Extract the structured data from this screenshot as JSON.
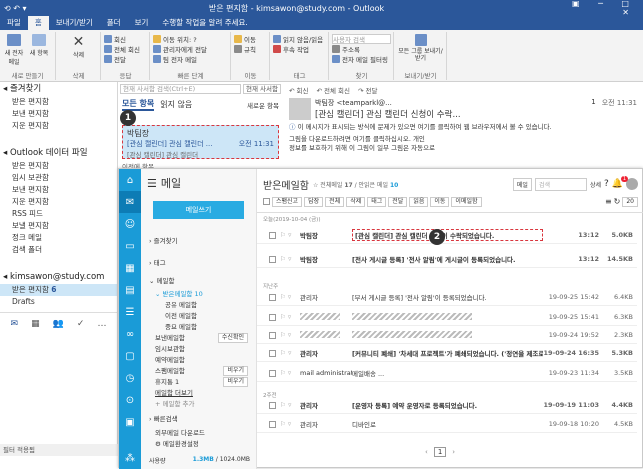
{
  "outlook": {
    "title": "받은 편지함 - kimsawon@study.com - Outlook",
    "tabs": [
      "파일",
      "홈",
      "보내기/받기",
      "폴더",
      "보기",
      "수행할 작업을 알려 주세요."
    ],
    "ribbon": {
      "new_email": "새 전자 메일",
      "new_items": "새 항목",
      "delete": "삭제",
      "reply": "회신",
      "reply_all": "전체 회신",
      "forward": "전달",
      "move_to": "이동 위치: ?",
      "to_manager": "관리자에게 전달",
      "team_email": "팀 전자 메일",
      "move": "이동",
      "rules": "규칙",
      "unread_read": "읽지 않음/읽음",
      "follow_up": "후속 작업",
      "search_people": "사용자 검색",
      "address_book": "주소록",
      "filter_email": "전자 메일 필터링",
      "all_groups": "모든 그룹 보내기/받기",
      "groups": [
        "새로 만들기",
        "삭제",
        "응답",
        "빠른 단계",
        "이동",
        "태그",
        "찾기",
        "보내기/받기"
      ]
    },
    "nav": {
      "favorites": "즐겨찾기",
      "fav_items": [
        "받은 편지함",
        "보낸 편지함",
        "지운 편지함"
      ],
      "data_file": "Outlook 데이터 파일",
      "data_items": [
        "받은 편지함",
        "임시 보관함",
        "보낸 편지함",
        "지운 편지함",
        "RSS 피드",
        "보낼 편지함",
        "정크 메일",
        "검색 폴더"
      ],
      "account": "kimsawon@study.com",
      "acc_inbox": "받은 편지함",
      "acc_inbox_count": "6",
      "acc_drafts": "Drafts",
      "status": "필터 적용됨"
    },
    "list": {
      "search_placeholder": "현재 사서함 검색(Ctrl+E)",
      "scope": "현재 사서함",
      "tab_all": "모든 항목",
      "tab_unread": "읽지 않음",
      "sort": "새로운 항목",
      "today": "오늘",
      "sender": "박팀장",
      "subject": "[관심 캘린더] 관심 캘린더 ...",
      "time": "오전 11:31",
      "preview": "[관심 캘린더] 관심 캘린더",
      "group_last": "이전에 항목"
    },
    "reading": {
      "reply": "회신",
      "reply_all": "전체 회신",
      "forward": "전달",
      "from": "박팀장 <teamparkl@...",
      "people": "1",
      "time": "오전 11:31",
      "subject": "[관심 캘린더] 관심 캘린더 신청이 수락...",
      "info": "이 메시지가 표시되는 방식에 문제가 있으면 여기를 클릭하여 웹 브라우저에서 볼 수 있습니다.",
      "body1": "그림을 다운로드하려면 여기를 클릭하십시오. 개인",
      "body2": "정보를 보호하기 위해 이 그림이 일부 그림은 자동으로"
    },
    "badge1": "1"
  },
  "webmail": {
    "logo": "메일",
    "compose": "메일쓰기",
    "side": [
      "즐겨찾기",
      "태그",
      "메일함",
      "받은메일함",
      "공유 메일함",
      "이전 메일함",
      "중요 메일함",
      "보낸메일함",
      "임시보관함",
      "예약메일함",
      "스팸메일함",
      "휴지통",
      "메일함 더보기",
      "+ 메일함 추가",
      "빠른검색",
      "외부메일 다운로드",
      "메일환경설정"
    ],
    "side_count": "10",
    "trash_count": "1",
    "side_empty": "비우기",
    "side_ext": "수신확인",
    "storage": "사용량",
    "storage_used": "1.3MB",
    "storage_total": "1024.0MB",
    "header": {
      "title": "받은메일함",
      "total_label": "전체메일",
      "total": "17",
      "unread_label": "안읽은 메일",
      "unread": "10",
      "search_scope": "메일",
      "search_placeholder": "검색",
      "detail": "상세",
      "notif_count": "1"
    },
    "toolbar": [
      "스팸신고",
      "답장",
      "전체",
      "삭제",
      "태그",
      "전달",
      "읽음",
      "이동",
      "이메일함"
    ],
    "page_size": "20",
    "group_today": "오늘(2019-10-04 (금))",
    "group_week": "지난주",
    "group_2w": "2주전",
    "rows": [
      {
        "from": "박팀장",
        "subject": "[관심 캘린더] 관심 캘린더 신청이 수락되었습니다.",
        "date": "13:12",
        "size": "5.0KB"
      },
      {
        "from": "박팀장",
        "subject": "[전사 게시글 등록] '전사 알림'에 게시글이 등록되었습니다.",
        "date": "13:12",
        "size": "14.5KB"
      },
      {
        "from": "관리자",
        "subject": "[부서 게시글 등록] '전사 알림'이 등록되었습니다.",
        "date": "19-09-25 15:42",
        "size": "6.4KB"
      },
      {
        "from": "",
        "subject": "",
        "date": "19-09-25 15:41",
        "size": "6.3KB"
      },
      {
        "from": "",
        "subject": "",
        "date": "19-09-24 19:52",
        "size": "2.3KB"
      },
      {
        "from": "관리자",
        "subject": "[커뮤니티 폐쇄] '차세대 프로젝트'가 폐쇄되었습니다. ('정연을 제조로 커뮤니티를 삭제 합니다.')",
        "date": "19-09-24 16:35",
        "size": "5.3KB"
      },
      {
        "from": "mail administrator",
        "subject": "메일배송 ...",
        "date": "19-09-23 11:34",
        "size": "3.5KB"
      },
      {
        "from": "관리자",
        "subject": "[운영자 등록] 예약 운영자로 등록되었습니다.",
        "date": "19-09-19 11:03",
        "size": "4.4KB"
      },
      {
        "from": "관리자",
        "subject": "디바인로",
        "date": "19-09-18 10:20",
        "size": "4.5KB"
      }
    ],
    "pager": "1",
    "badge2": "2"
  },
  "colors": {
    "outlook_blue": "#2b579a",
    "web_blue": "#1a9bd7",
    "red_dash": "#d9363e"
  }
}
